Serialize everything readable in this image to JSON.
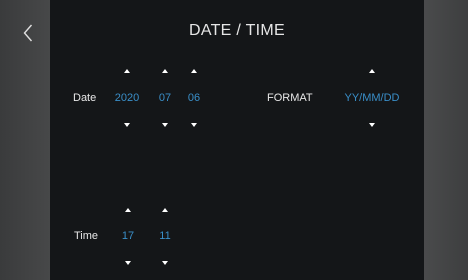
{
  "header": {
    "title": "DATE / TIME",
    "back_icon": "chevron-left-icon"
  },
  "date": {
    "label": "Date",
    "year": "2020",
    "month": "07",
    "day": "06"
  },
  "format": {
    "label": "FORMAT",
    "value": "YY/MM/DD"
  },
  "time": {
    "label": "Time",
    "hour": "17",
    "minute": "11"
  },
  "colors": {
    "value": "#3a8fc9",
    "panel": "#141618",
    "side": "#444546"
  }
}
